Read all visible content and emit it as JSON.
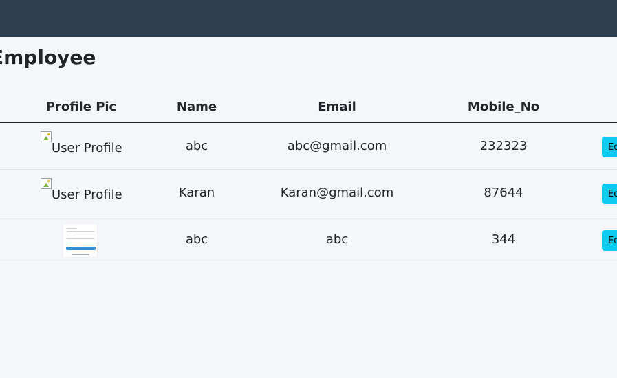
{
  "page": {
    "title": "Employee"
  },
  "table": {
    "headers": {
      "profile_pic": "Profile Pic",
      "name": "Name",
      "email": "Email",
      "mobile": "Mobile_No"
    },
    "rows": [
      {
        "pic_alt": "User Profile",
        "name": "abc",
        "email": "abc@gmail.com",
        "mobile": "232323",
        "action": "Edit"
      },
      {
        "pic_alt": "User Profile",
        "name": "Karan",
        "email": "Karan@gmail.com",
        "mobile": "87644",
        "action": "Edit"
      },
      {
        "pic_alt": "",
        "name": "abc",
        "email": "abc",
        "mobile": "344",
        "action": "Edit"
      }
    ]
  },
  "colors": {
    "navbar": "#2c3e50",
    "background": "#f4f6fa",
    "edit_button": "#0dcaf0"
  }
}
